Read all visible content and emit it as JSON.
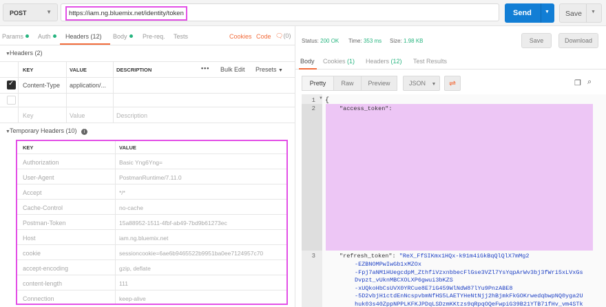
{
  "request": {
    "method": "POST",
    "url": "https://iam.ng.bluemix.net/identity/token",
    "send_label": "Send",
    "save_label": "Save"
  },
  "req_tabs": [
    {
      "label": "Params",
      "dot": true
    },
    {
      "label": "Auth",
      "dot": true
    },
    {
      "label": "Headers (12)"
    },
    {
      "label": "Body",
      "dot": true
    },
    {
      "label": "Pre-req."
    },
    {
      "label": "Tests"
    }
  ],
  "req_links": {
    "cookies": "Cookies",
    "code": "Code",
    "comments": "(0)"
  },
  "headers_section": {
    "title": "Headers (2)",
    "columns": [
      "KEY",
      "VALUE",
      "DESCRIPTION"
    ],
    "bulk_edit": "Bulk Edit",
    "presets": "Presets",
    "rows": [
      {
        "checked": true,
        "key": "Content-Type",
        "value": "application/...",
        "description": ""
      },
      {
        "checked": false,
        "key": "",
        "value": "",
        "description": ""
      }
    ],
    "placeholder": {
      "key": "Key",
      "value": "Value",
      "description": "Description"
    }
  },
  "temp_headers": {
    "title": "Temporary Headers (10)",
    "columns": [
      "KEY",
      "VALUE"
    ],
    "rows": [
      {
        "key": "Authorization",
        "value": "Basic Yng6Yng="
      },
      {
        "key": "User-Agent",
        "value": "PostmanRuntime/7.11.0"
      },
      {
        "key": "Accept",
        "value": "*/*"
      },
      {
        "key": "Cache-Control",
        "value": "no-cache"
      },
      {
        "key": "Postman-Token",
        "value": "15a88952-1511-4fbf-ab49-7bd9b61273ec"
      },
      {
        "key": "Host",
        "value": "iam.ng.bluemix.net"
      },
      {
        "key": "cookie",
        "value": "sessioncookie=6ae6b9465522b9951ba0ee7124957c70"
      },
      {
        "key": "accept-encoding",
        "value": "gzip, deflate"
      },
      {
        "key": "content-length",
        "value": "111"
      },
      {
        "key": "Connection",
        "value": "keep-alive"
      }
    ]
  },
  "response": {
    "status_label": "Status:",
    "status": "200 OK",
    "time_label": "Time:",
    "time": "353 ms",
    "size_label": "Size:",
    "size": "1.98 KB",
    "save_btn": "Save",
    "download_btn": "Download",
    "tabs": [
      {
        "label": "Body"
      },
      {
        "label": "Cookies",
        "count": "(1)"
      },
      {
        "label": "Headers",
        "count": "(12)"
      },
      {
        "label": "Test Results"
      }
    ],
    "view_modes": [
      "Pretty",
      "Raw",
      "Preview"
    ],
    "format": "JSON",
    "code_lines": [
      {
        "n": "1",
        "text": "{"
      },
      {
        "n": "2",
        "key": "\"access_token\":",
        "value": ""
      },
      {
        "n": "3",
        "key": "\"refresh_token\":",
        "value": "\"ReX_FfSIKmx1HQx-k91m4iGkBqQlQlX7mMg2"
      }
    ],
    "refresh_cont": [
      "-EZBNOMPwIwGb1xMZOx",
      "-Fpj7aNM1HUegcdpM_ZthfiVzxnbbecFlGse3VZl7YsYqpArWv3bj3fWri5xLVxGs",
      "Dvpzt_vUknMBCXOLXP6gwui3bKZS",
      "-xUQkoHbCsUVX0YRCue8E7iG459WlNdW87lYu9PnzABE8",
      "-5D2vbjH1ctdEnNcspvbmNfHS5LAETYHeNtNjj2hBjmkFkGOKrwedqbwpNQ0yga2U",
      "huk03s40ZppNPPLKFKJPDqLSDzmKKtzs9qRpqOQeFwpiG39B21YTB71fHv_vm4STk"
    ]
  }
}
